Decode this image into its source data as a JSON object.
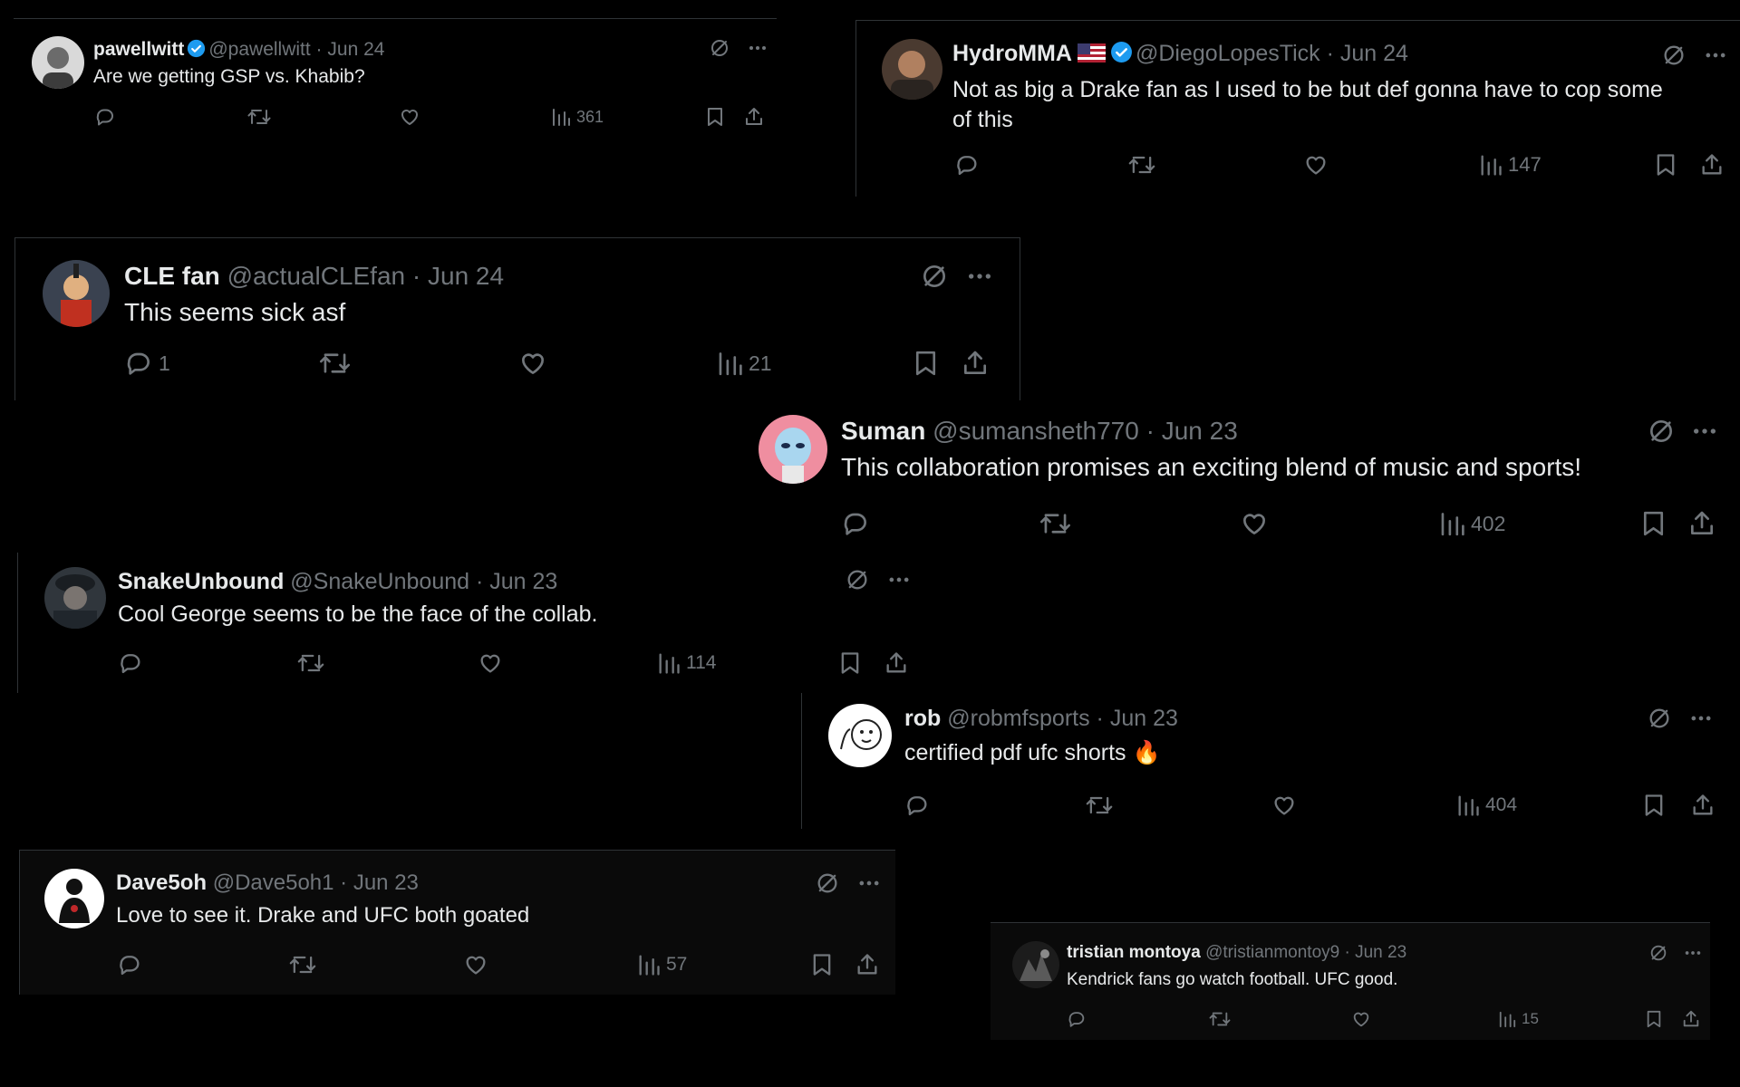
{
  "colors": {
    "background": "#000000",
    "text": "#e7e9ea",
    "secondary": "#71767b",
    "verified": "#1d9bf0"
  },
  "tweets": [
    {
      "name": "pawellwitt",
      "verified": true,
      "handle": "@pawellwitt",
      "date": "Jun 24",
      "text": "Are we getting GSP vs. Khabib?",
      "replies": "",
      "views": "361",
      "avatar_icon": "person-photo"
    },
    {
      "name": "HydroMMA",
      "verified": true,
      "flag": "us-flag",
      "handle": "@DiegoLopesTick",
      "date": "Jun 24",
      "text": "Not as big a Drake fan as I used to be but def gonna have to cop some of this",
      "replies": "",
      "views": "147",
      "avatar_icon": "fighter-photo"
    },
    {
      "name": "CLE fan",
      "verified": false,
      "handle": "@actualCLEfan",
      "date": "Jun 24",
      "text": "This seems sick asf",
      "replies": "1",
      "views": "21",
      "avatar_icon": "cartoon-character"
    },
    {
      "name": "Suman",
      "verified": false,
      "handle": "@sumansheth770",
      "date": "Jun 23",
      "text": "This collaboration promises an exciting blend of music and sports!",
      "replies": "",
      "views": "402",
      "avatar_icon": "alien-avatar"
    },
    {
      "name": "SnakeUnbound",
      "verified": false,
      "handle": "@SnakeUnbound",
      "date": "Jun 23",
      "text": "Cool George seems to be the face of the collab.",
      "replies": "",
      "views": "114",
      "avatar_icon": "soldier-avatar"
    },
    {
      "name": "rob",
      "verified": false,
      "handle": "@robmfsports",
      "date": "Jun 23",
      "text": "certified pdf ufc shorts",
      "emoji": "🔥",
      "replies": "",
      "views": "404",
      "avatar_icon": "doodle-avatar"
    },
    {
      "name": "Dave5oh",
      "verified": false,
      "handle": "@Dave5oh1",
      "date": "Jun 23",
      "text": "Love to see it. Drake and UFC both goated",
      "replies": "",
      "views": "57",
      "avatar_icon": "target-avatar"
    },
    {
      "name": "tristian montoya",
      "verified": false,
      "handle": "@tristianmontoy9",
      "date": "Jun 23",
      "text": "Kendrick fans go watch football. UFC good.",
      "replies": "",
      "views": "15",
      "avatar_icon": "dark-photo"
    }
  ]
}
